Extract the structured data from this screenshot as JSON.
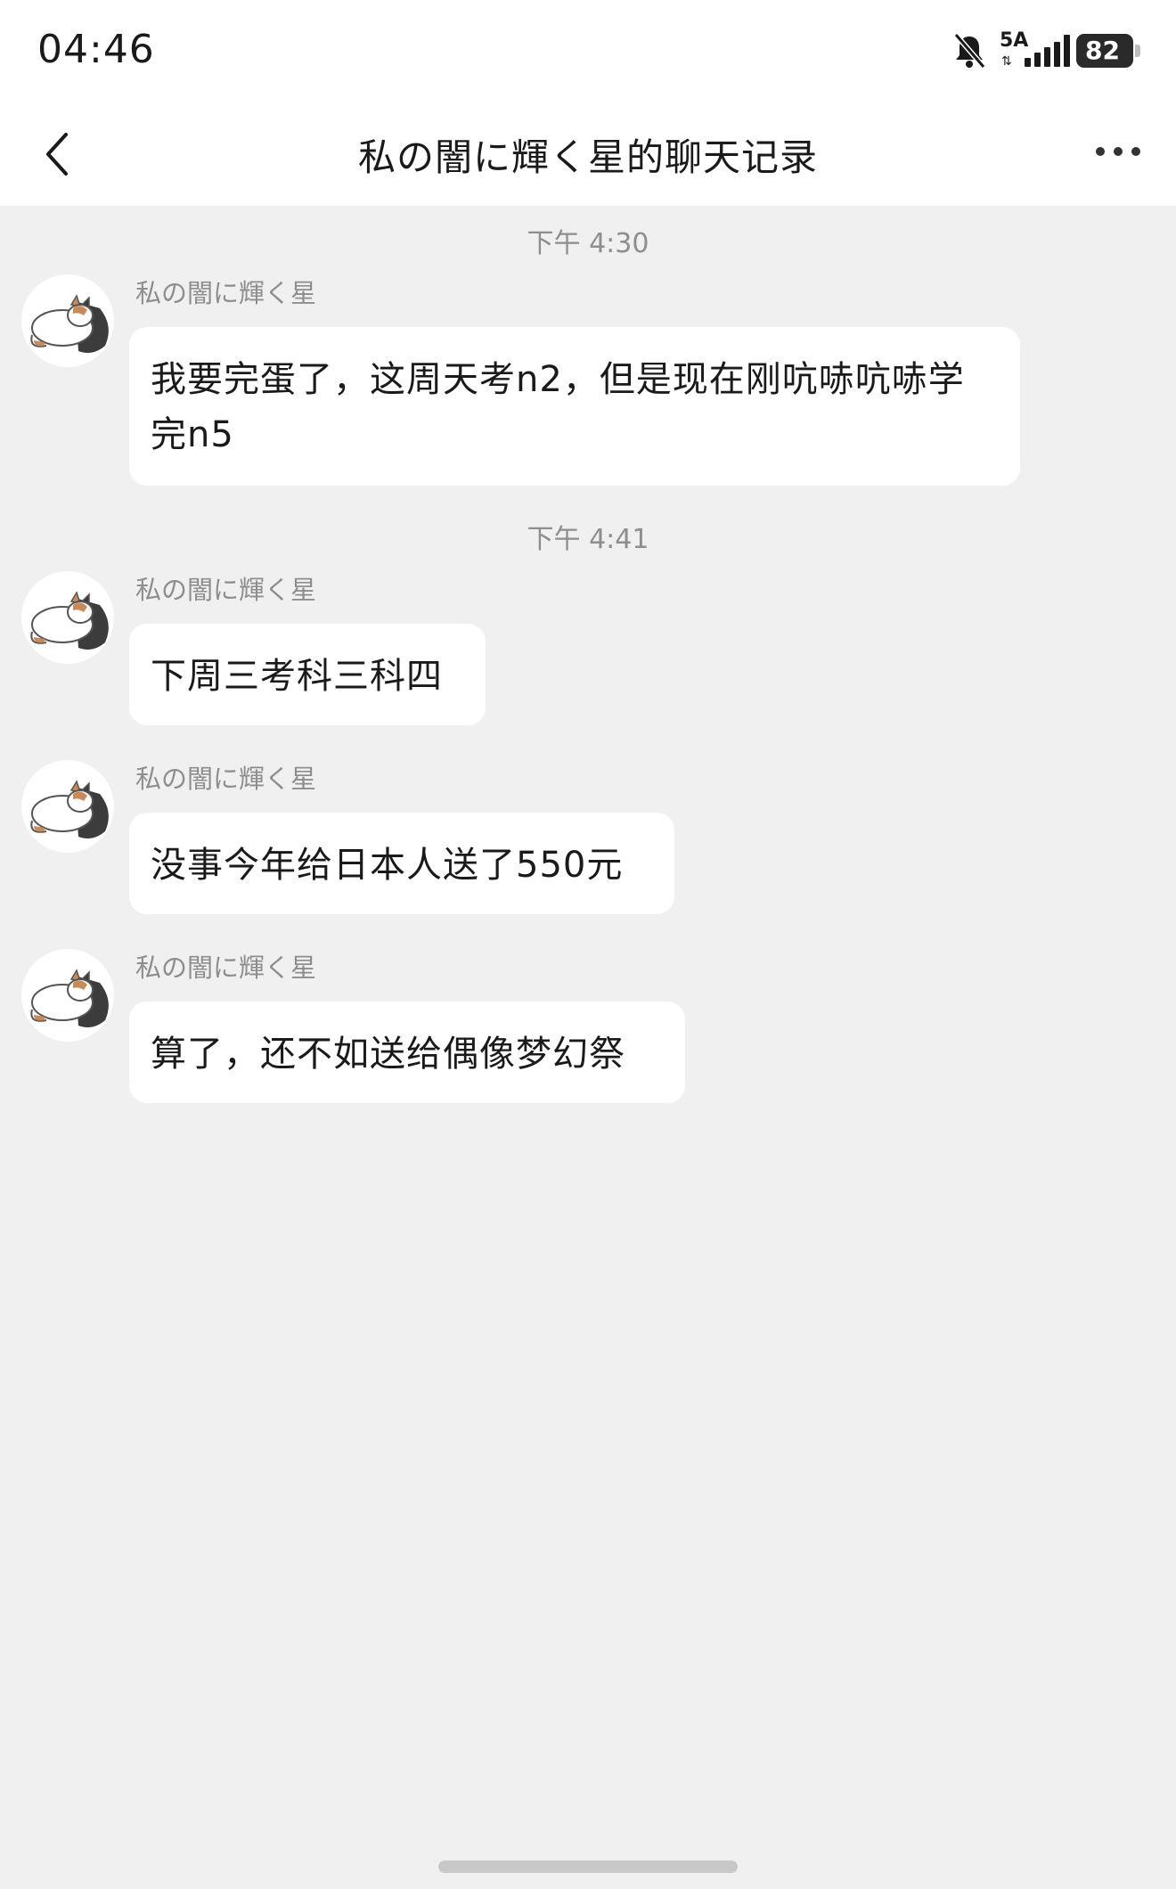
{
  "status_bar": {
    "time": "04:46",
    "network_label": "5A",
    "battery_level": "82",
    "icons": [
      "bell-muted-icon",
      "signal-icon",
      "battery-icon"
    ]
  },
  "nav": {
    "title": "私の闇に輝く星的聊天记录",
    "icons": [
      "chevron-left-icon",
      "more-icon"
    ]
  },
  "time_separators": [
    "下午 4:30",
    "下午 4:41"
  ],
  "messages": [
    {
      "sender": "私の闇に輝く星",
      "text": "我要完蛋了，这周天考n2，但是现在刚吭哧吭哧学完n5"
    },
    {
      "sender": "私の闇に輝く星",
      "text": "下周三考科三科四"
    },
    {
      "sender": "私の闇に輝く星",
      "text": "没事今年给日本人送了550元"
    },
    {
      "sender": "私の闇に輝く星",
      "text": "算了，还不如送给偶像梦幻祭"
    }
  ],
  "colors": {
    "background": "#f0f0f0",
    "bubble": "#ffffff",
    "meta_text": "#8e8e8e"
  }
}
